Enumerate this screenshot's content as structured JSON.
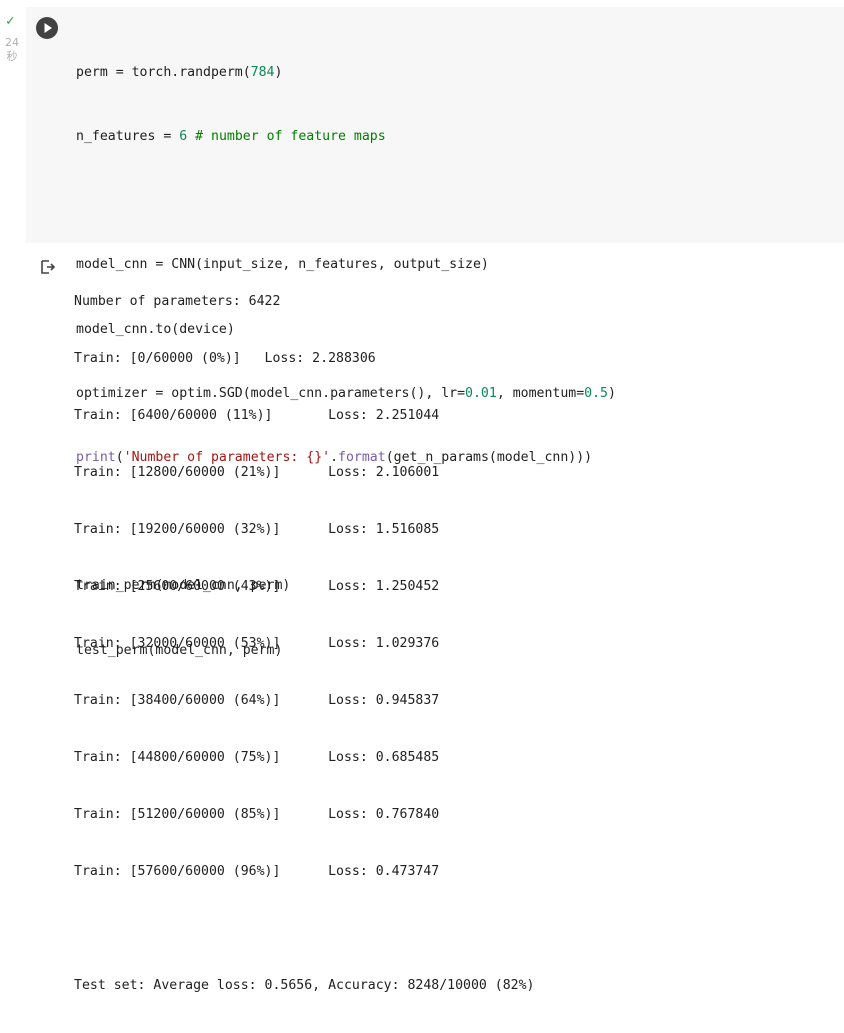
{
  "gutter": {
    "status_icon": "check-icon",
    "exec_time_value": "24",
    "exec_time_unit": "秒"
  },
  "code_cell": {
    "run_icon": "play-icon",
    "lines": [
      "perm = torch.randperm(784)",
      "n_features = 6 # number of feature maps",
      "",
      "model_cnn = CNN(input_size, n_features, output_size)",
      "model_cnn.to(device)",
      "optimizer = optim.SGD(model_cnn.parameters(), lr=0.01, momentum=0.5)",
      "print('Number of parameters: {}'.format(get_n_params(model_cnn)))",
      "",
      "train_perm(model_cnn, perm)",
      "test_perm(model_cnn, perm)"
    ]
  },
  "output": {
    "icon": "output-arrow-icon",
    "lines": [
      "Number of parameters: 6422",
      "Train: [0/60000 (0%)]   Loss: 2.288306",
      "Train: [6400/60000 (11%)]       Loss: 2.251044",
      "Train: [12800/60000 (21%)]      Loss: 2.106001",
      "Train: [19200/60000 (32%)]      Loss: 1.516085",
      "Train: [25600/60000 (43%)]      Loss: 1.250452",
      "Train: [32000/60000 (53%)]      Loss: 1.029376",
      "Train: [38400/60000 (64%)]      Loss: 0.945837",
      "Train: [44800/60000 (75%)]      Loss: 0.685485",
      "Train: [51200/60000 (85%)]      Loss: 0.767840",
      "Train: [57600/60000 (96%)]      Loss: 0.473747",
      "",
      "Test set: Average loss: 0.5656, Accuracy: 8248/10000 (82%)"
    ]
  },
  "colors": {
    "number": "#09885a",
    "keyword": "#795da3",
    "string": "#a31515",
    "comment": "#008000"
  }
}
